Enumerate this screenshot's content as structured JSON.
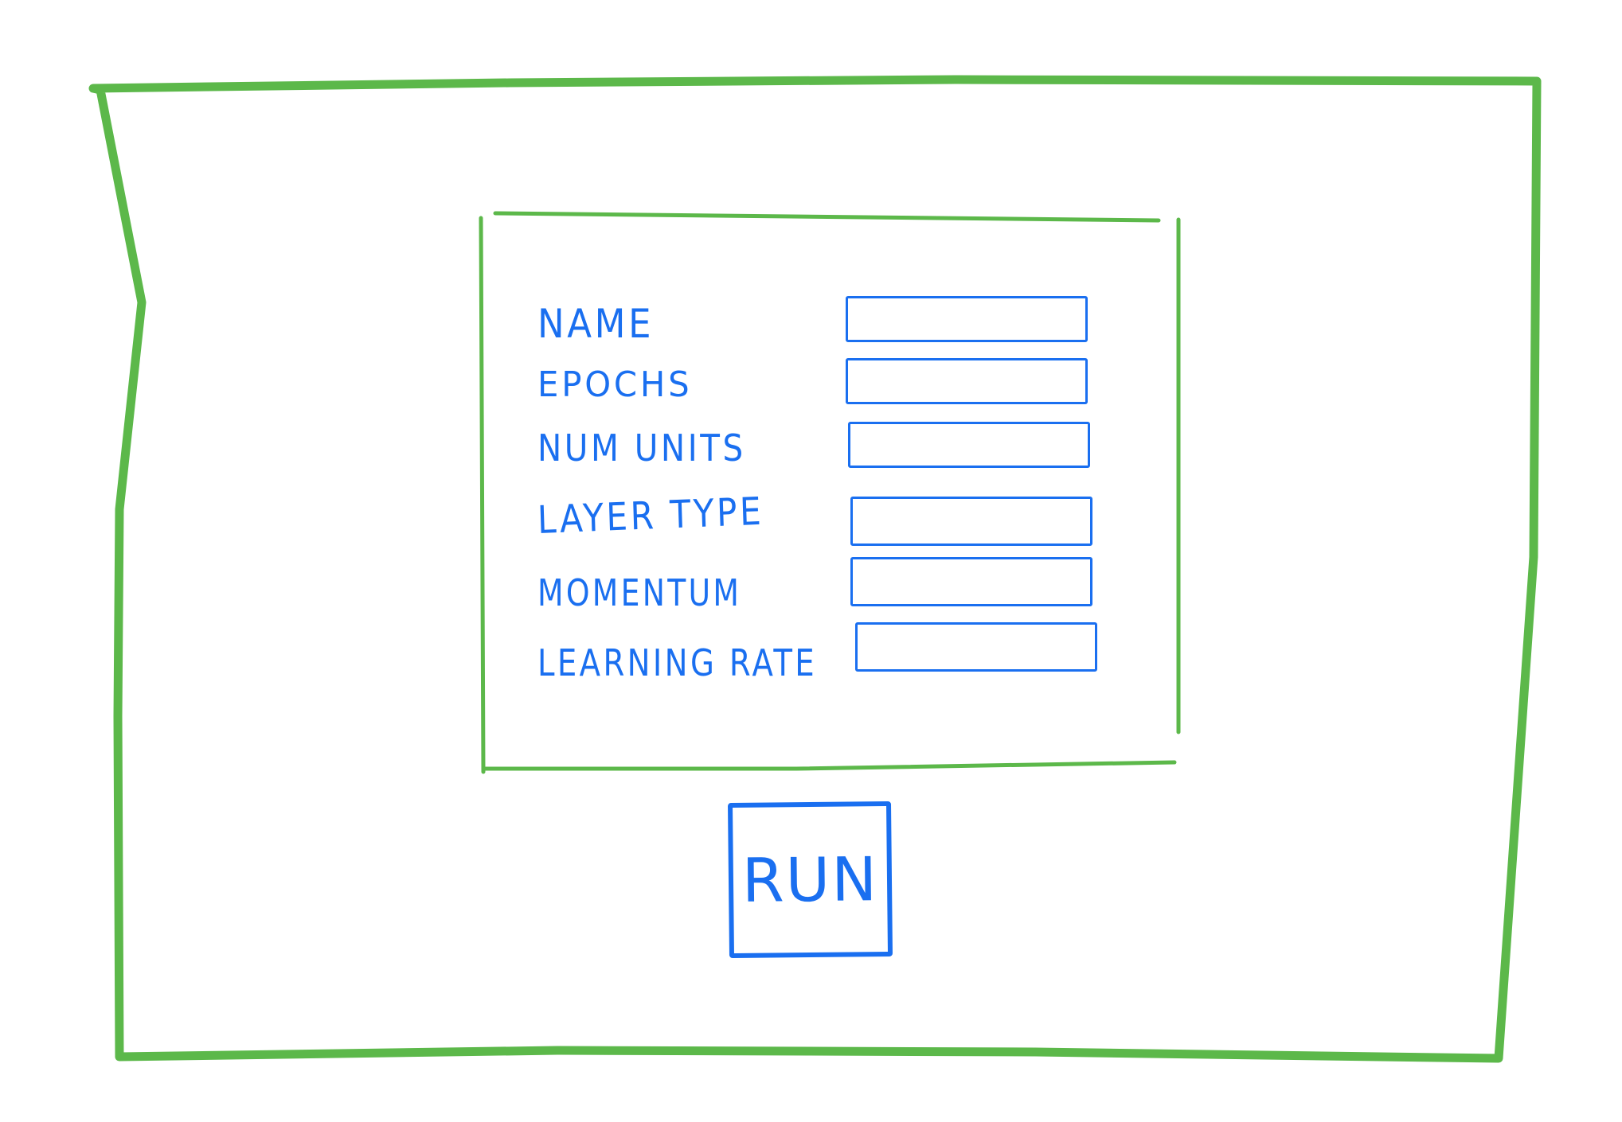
{
  "form": {
    "fields": [
      {
        "label": "NAME",
        "value": "",
        "placeholder": ""
      },
      {
        "label": "EPOCHS",
        "value": "",
        "placeholder": ""
      },
      {
        "label": "NUM UNITS",
        "value": "",
        "placeholder": ""
      },
      {
        "label": "LAYER TYPE",
        "value": "",
        "placeholder": ""
      },
      {
        "label": "MOMENTUM",
        "value": "",
        "placeholder": ""
      },
      {
        "label": "LEARNING RATE",
        "value": "",
        "placeholder": ""
      }
    ]
  },
  "actions": {
    "run_label": "RUN"
  },
  "colors": {
    "frame": "#5cb84a",
    "ink": "#1a6ff0"
  }
}
